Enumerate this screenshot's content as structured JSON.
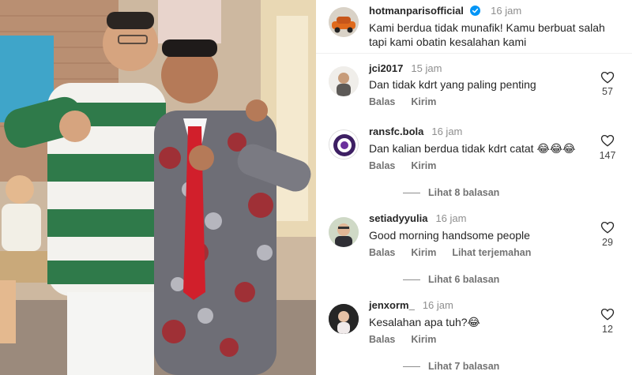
{
  "caption": {
    "username": "hotmanparisofficial",
    "time": "16 jam",
    "text": "Kami berdua tidak munafik! Kamu berbuat salah tapi kami obatin kesalahan kami"
  },
  "comments": [
    {
      "username": "jci2017",
      "time": "15 jam",
      "text": "Dan tidak kdrt yang paling penting",
      "reply": "Balas",
      "send": "Kirim",
      "likes": "57"
    },
    {
      "username": "ransfc.bola",
      "time": "16 jam",
      "text": "Dan kalian berdua tidak kdrt catat 😂😂😂",
      "reply": "Balas",
      "send": "Kirim",
      "likes": "147",
      "view_replies": "Lihat 8 balasan"
    },
    {
      "username": "setiadyyulia",
      "time": "16 jam",
      "text": "Good morning handsome people",
      "reply": "Balas",
      "send": "Kirim",
      "translate": "Lihat terjemahan",
      "likes": "29",
      "view_replies": "Lihat 6 balasan"
    },
    {
      "username": "jenxorm_",
      "time": "16 jam",
      "text": "Kesalahan apa tuh?😂",
      "reply": "Balas",
      "send": "Kirim",
      "likes": "12",
      "view_replies": "Lihat 7 balasan"
    }
  ],
  "colors": {
    "verified": "#0095f6",
    "muted": "#737373",
    "text": "#262626"
  },
  "icons": [
    "heart-icon",
    "verified-badge-icon"
  ]
}
